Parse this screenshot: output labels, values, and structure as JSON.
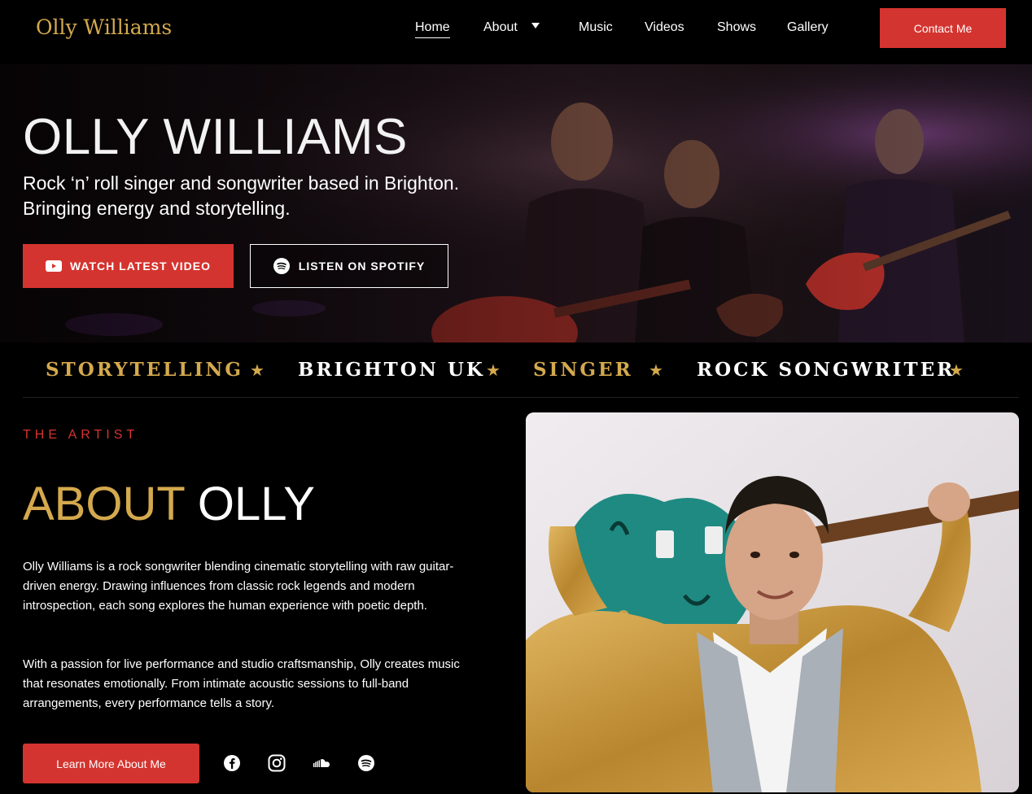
{
  "nav": {
    "logo": "Olly Williams",
    "links": [
      {
        "label": "Home"
      },
      {
        "label": "About"
      },
      {
        "label": "Music"
      },
      {
        "label": "Videos"
      },
      {
        "label": "Shows"
      },
      {
        "label": "Gallery"
      }
    ],
    "contact_label": "Contact Me"
  },
  "hero": {
    "title": "OLLY WILLIAMS",
    "subtitle_line1": "Rock ‘n’ roll singer and songwriter based in Brighton.",
    "subtitle_line2": "Bringing energy and storytelling.",
    "video_button": "WATCH LATEST VIDEO",
    "spotify_button": "LISTEN ON SPOTIFY"
  },
  "ticker": {
    "items": [
      "STORYTELLING",
      "BRIGHTON UK",
      "SINGER",
      "ROCK SONGWRITER"
    ],
    "star": "★"
  },
  "about": {
    "eyebrow": "THE ARTIST",
    "title_gold": "ABOUT",
    "title_white": "OLLY",
    "paragraph1": "Olly Williams is a rock songwriter blending cinematic storytelling with raw guitar-driven energy. Drawing influences from classic rock legends and modern introspection, each song explores the human experience with poetic depth.",
    "paragraph2": "With a passion for live performance and studio craftsmanship, Olly creates music that resonates emotionally. From intimate acoustic sessions to full-band arrangements, every performance tells a story.",
    "learn_button": "Learn More About Me",
    "social_icons": [
      "facebook-icon",
      "instagram-icon",
      "soundcloud-icon",
      "spotify-icon"
    ]
  },
  "colors": {
    "accent_red": "#d4342f",
    "gold": "#d4a94e",
    "background": "#000000"
  }
}
